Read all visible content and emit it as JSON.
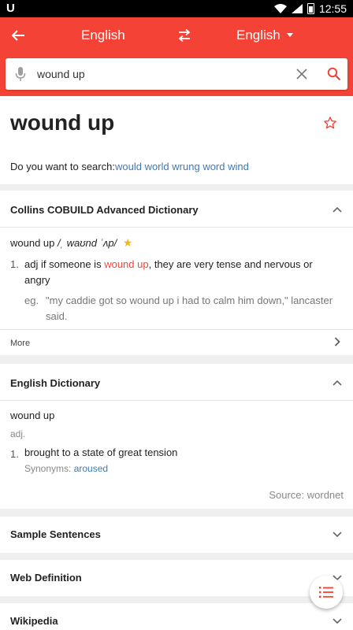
{
  "status_bar": {
    "time": "12:55",
    "app_icon": "U"
  },
  "header": {
    "source_language": "English",
    "target_language": "English"
  },
  "search": {
    "value": "wound up",
    "placeholder": ""
  },
  "headword": {
    "title": "wound up",
    "suggest_prefix": "Do you want to search:",
    "suggestions": [
      "would",
      "world",
      "wrung",
      "word",
      "wind"
    ]
  },
  "collins": {
    "title": "Collins COBUILD Advanced Dictionary",
    "entry_word": "wound up",
    "pronunciation": "/ˌ waʊnd ˈʌp/",
    "sense_number": "1.",
    "sense_pos": "adj",
    "sense_before": "if someone is",
    "sense_highlight": "wound up",
    "sense_after": ", they are very tense and nervous or angry",
    "eg_label": "eg.",
    "example": "\"my caddie got so wound up i had to calm him down,\" lancaster said.",
    "more_label": "More"
  },
  "english_dict": {
    "title": "English Dictionary",
    "entry_word": "wound up",
    "part_of_speech": "adj.",
    "sense_number": "1.",
    "definition": "brought to a state of great tension",
    "synonyms_label": "Synonyms:",
    "synonym": "aroused",
    "source": "Source: wordnet"
  },
  "sections": {
    "sample_sentences": "Sample Sentences",
    "web_definition": "Web Definition",
    "wikipedia": "Wikipedia"
  },
  "colors": {
    "accent": "#f44336",
    "link": "#3d7ab8",
    "star": "#f3b71e"
  },
  "icons": [
    "back-arrow-icon",
    "swap-icon",
    "chevron-down-icon",
    "mic-icon",
    "clear-icon",
    "search-icon",
    "star-outline-icon",
    "star-filled-icon",
    "chevron-up-icon",
    "chevron-right-icon",
    "list-icon"
  ]
}
